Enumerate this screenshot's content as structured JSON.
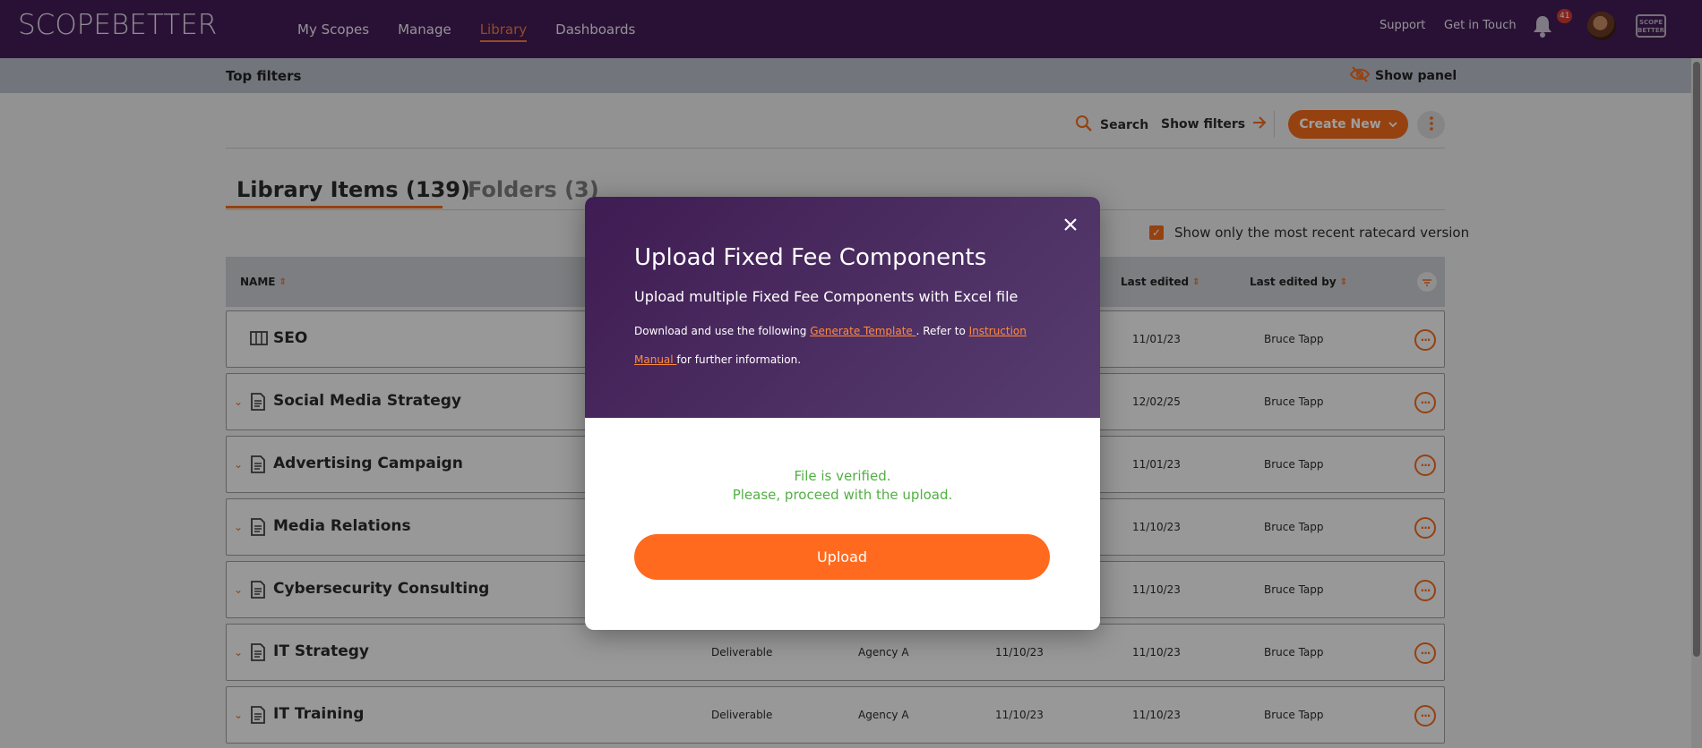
{
  "app": {
    "logo_text": "SCOPEBETTER"
  },
  "nav": {
    "links": [
      {
        "label": "My Scopes",
        "active": false
      },
      {
        "label": "Manage",
        "active": false
      },
      {
        "label": "Library",
        "active": true
      },
      {
        "label": "Dashboards",
        "active": false
      }
    ],
    "support": "Support",
    "get_in_touch": "Get in Touch",
    "notification_count": "41",
    "mini_logo": "SCOPE BETTER"
  },
  "filters": {
    "title": "Top filters",
    "show_panel": "Show panel"
  },
  "toolbar": {
    "search": "Search",
    "show_filters": "Show filters",
    "create_new": "Create New"
  },
  "tabs": [
    {
      "label": "Library Items (139)",
      "active": true
    },
    {
      "label": "Folders (3)",
      "active": false
    }
  ],
  "recent_toggle": {
    "label": "Show only the most recent ratecard version",
    "checked": true
  },
  "table": {
    "headers": {
      "name": "NAME",
      "last_edited": "Last edited",
      "last_edited_by": "Last edited by"
    },
    "rows": [
      {
        "name": "SEO",
        "icon": "columns-icon",
        "type": "",
        "agency": "",
        "created": "",
        "edited": "11/01/23",
        "by": "Bruce Tapp",
        "expandable": false
      },
      {
        "name": "Social Media Strategy",
        "icon": "document-icon",
        "type": "",
        "agency": "",
        "created": "",
        "edited": "12/02/25",
        "by": "Bruce Tapp",
        "expandable": true
      },
      {
        "name": "Advertising Campaign",
        "icon": "document-icon",
        "type": "",
        "agency": "",
        "created": "",
        "edited": "11/01/23",
        "by": "Bruce Tapp",
        "expandable": true
      },
      {
        "name": "Media Relations",
        "icon": "document-icon",
        "type": "",
        "agency": "",
        "created": "",
        "edited": "11/10/23",
        "by": "Bruce Tapp",
        "expandable": true
      },
      {
        "name": "Cybersecurity Consulting",
        "icon": "document-icon",
        "type": "",
        "agency": "",
        "created": "",
        "edited": "11/10/23",
        "by": "Bruce Tapp",
        "expandable": true
      },
      {
        "name": "IT Strategy",
        "icon": "document-icon",
        "type": "Deliverable",
        "agency": "Agency A",
        "created": "11/10/23",
        "edited": "11/10/23",
        "by": "Bruce Tapp",
        "expandable": true
      },
      {
        "name": "IT Training",
        "icon": "document-icon",
        "type": "Deliverable",
        "agency": "Agency A",
        "created": "11/10/23",
        "edited": "11/10/23",
        "by": "Bruce Tapp",
        "expandable": true
      }
    ]
  },
  "modal": {
    "title": "Upload Fixed Fee Components",
    "subtitle": "Upload multiple Fixed Fee Components with Excel file",
    "desc_prefix": "Download and use the following ",
    "template_link": "Generate Template ",
    "desc_middle": ". Refer to ",
    "manual_link": "Instruction Manual ",
    "desc_suffix": "for further information.",
    "verified_line1": "File is verified.",
    "verified_line2": "Please, proceed with the upload.",
    "upload_button": "Upload"
  },
  "colors": {
    "nav_bg": "#431c57",
    "accent": "#f26a1b",
    "success": "#52b043"
  }
}
